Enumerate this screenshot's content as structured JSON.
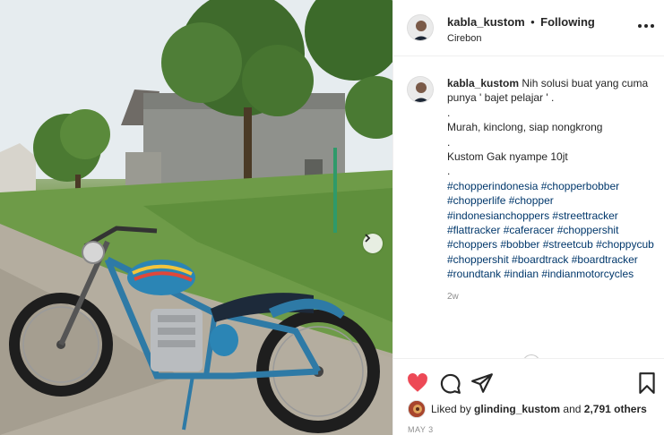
{
  "post": {
    "username": "kabla_kustom",
    "separator": "•",
    "follow_status": "Following",
    "location": "Cirebon"
  },
  "caption": {
    "username": "kabla_kustom",
    "line1": "Nih solusi buat yang cuma punya ' bajet pelajar ' .",
    "spacer1": ".",
    "line2": "Murah, kinclong, siap nongkrong",
    "spacer2": ".",
    "line3": "Kustom Gak nyampe 10jt",
    "spacer3": ".",
    "hashtags": "#chopperindonesia #chopperbobber #chopperlife #chopper #indonesianchoppers #streettracker #flattracker #caferacer #choppershit #choppers #bobber #streetcub #choppycub #choppershit #boardtrack #boardtracker #roundtank #indian #indianmotorcycles",
    "age": "2w"
  },
  "likes": {
    "prefix": "Liked by",
    "liker": "glinding_kustom",
    "suffix": "and",
    "count": "2,791 others"
  },
  "date": "MAY 3",
  "icons": {
    "like": "heart-icon",
    "comment": "comment-icon",
    "share": "share-icon",
    "save": "bookmark-icon",
    "more": "more-options-icon",
    "next": "chevron-right-icon"
  },
  "colors": {
    "like_active": "#ed4956",
    "hashtag": "#00376b",
    "muted": "#8e8e8e"
  }
}
